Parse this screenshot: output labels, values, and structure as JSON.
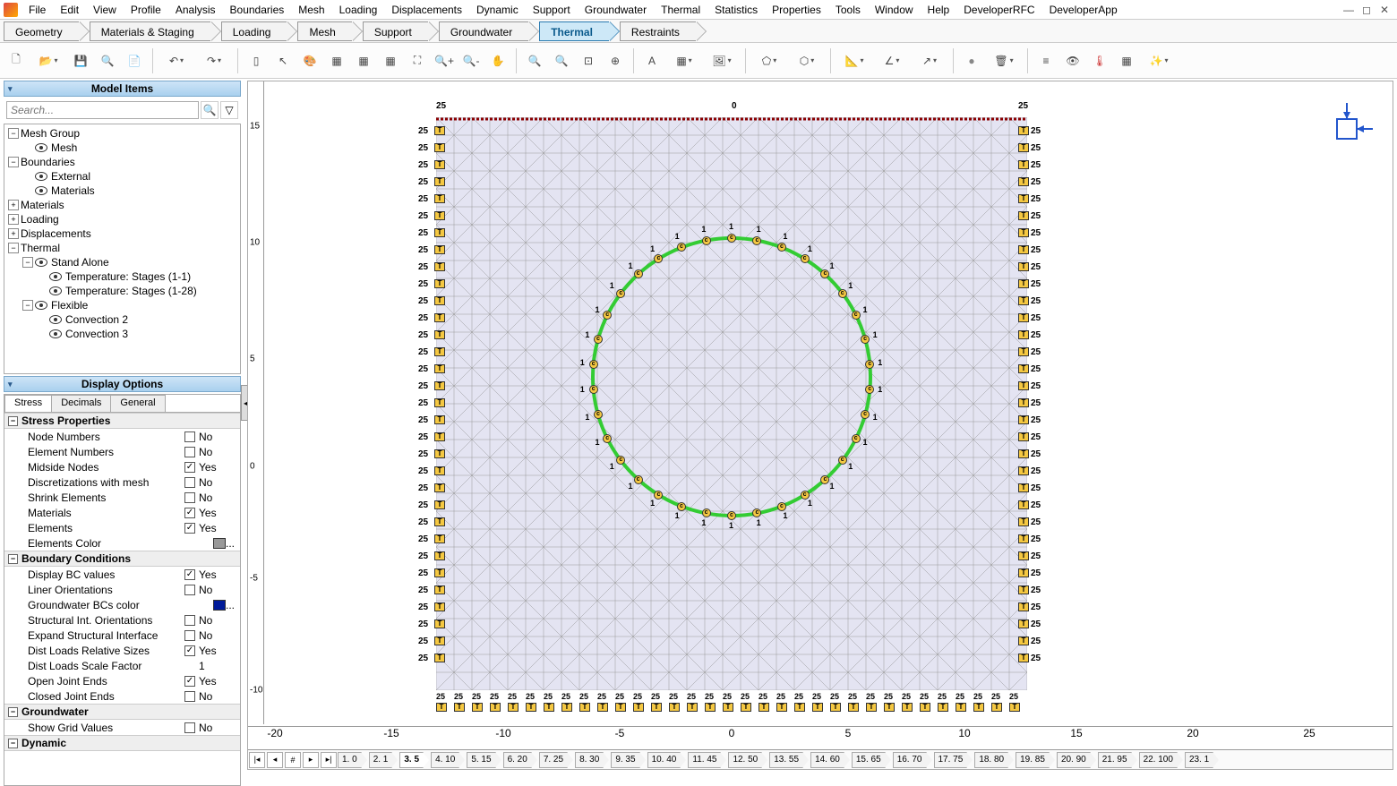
{
  "menu": [
    "File",
    "Edit",
    "View",
    "Profile",
    "Analysis",
    "Boundaries",
    "Mesh",
    "Loading",
    "Displacements",
    "Dynamic",
    "Support",
    "Groundwater",
    "Thermal",
    "Statistics",
    "Properties",
    "Tools",
    "Window",
    "Help",
    "DeveloperRFC",
    "DeveloperApp"
  ],
  "workflow": {
    "tabs": [
      "Geometry",
      "Materials & Staging",
      "Loading",
      "Mesh",
      "Support",
      "Groundwater",
      "Thermal",
      "Restraints"
    ],
    "active": "Thermal"
  },
  "model_items": {
    "title": "Model Items",
    "search_placeholder": "Search...",
    "tree": [
      {
        "label": "Mesh Group",
        "children": [
          {
            "label": "Mesh",
            "eye": true
          }
        ]
      },
      {
        "label": "Boundaries",
        "children": [
          {
            "label": "External",
            "eye": true
          },
          {
            "label": "Materials",
            "eye": true
          }
        ]
      },
      {
        "label": "Materials",
        "collapsed": true
      },
      {
        "label": "Loading",
        "collapsed": true
      },
      {
        "label": "Displacements",
        "collapsed": true
      },
      {
        "label": "Thermal",
        "children": [
          {
            "label": "Stand Alone",
            "eye": true,
            "children": [
              {
                "label": "Temperature: Stages (1-1)",
                "eye": true
              },
              {
                "label": "Temperature: Stages (1-28)",
                "eye": true
              }
            ]
          },
          {
            "label": "Flexible",
            "eye": true,
            "children": [
              {
                "label": "Convection 2",
                "eye": true
              },
              {
                "label": "Convection 3",
                "eye": true
              }
            ]
          }
        ]
      }
    ]
  },
  "display_options": {
    "title": "Display Options",
    "tabs": [
      "Stress",
      "Decimals",
      "General"
    ],
    "active_tab": "Stress",
    "sections": [
      {
        "name": "Stress Properties",
        "rows": [
          {
            "label": "Node Numbers",
            "checked": false,
            "val": "No"
          },
          {
            "label": "Element Numbers",
            "checked": false,
            "val": "No"
          },
          {
            "label": "Midside Nodes",
            "checked": true,
            "val": "Yes"
          },
          {
            "label": "Discretizations with mesh",
            "checked": false,
            "val": "No"
          },
          {
            "label": "Shrink Elements",
            "checked": false,
            "val": "No"
          },
          {
            "label": "Materials",
            "checked": true,
            "val": "Yes"
          },
          {
            "label": "Elements",
            "checked": true,
            "val": "Yes"
          },
          {
            "label": "Elements Color",
            "swatch": "#999",
            "ell": "..."
          }
        ]
      },
      {
        "name": "Boundary Conditions",
        "rows": [
          {
            "label": "Display BC values",
            "checked": true,
            "val": "Yes"
          },
          {
            "label": "Liner Orientations",
            "checked": false,
            "val": "No"
          },
          {
            "label": "Groundwater BCs color",
            "swatch": "#001a99",
            "ell": "..."
          },
          {
            "label": "Structural Int. Orientations",
            "checked": false,
            "val": "No"
          },
          {
            "label": "Expand Structural Interface",
            "checked": false,
            "val": "No"
          },
          {
            "label": "Dist Loads Relative Sizes",
            "checked": true,
            "val": "Yes"
          },
          {
            "label": "Dist Loads Scale Factor",
            "plain": "1"
          },
          {
            "label": "Open Joint Ends",
            "checked": true,
            "val": "Yes"
          },
          {
            "label": "Closed Joint Ends",
            "checked": false,
            "val": "No"
          }
        ]
      },
      {
        "name": "Groundwater",
        "rows": [
          {
            "label": "Show Grid Values",
            "checked": false,
            "val": "No"
          }
        ]
      },
      {
        "name": "Dynamic",
        "rows": []
      }
    ]
  },
  "canvas": {
    "top_labels": {
      "left": "25",
      "center": "0",
      "right": "25"
    },
    "boundary_temp": "25",
    "ruler_x": [
      {
        "pos": 30,
        "v": "-20"
      },
      {
        "pos": 160,
        "v": "-15"
      },
      {
        "pos": 285,
        "v": "-10"
      },
      {
        "pos": 415,
        "v": "-5"
      },
      {
        "pos": 540,
        "v": "0"
      },
      {
        "pos": 670,
        "v": "5"
      },
      {
        "pos": 800,
        "v": "10"
      },
      {
        "pos": 925,
        "v": "15"
      },
      {
        "pos": 1055,
        "v": "20"
      },
      {
        "pos": 1185,
        "v": "25"
      }
    ],
    "ruler_y": [
      {
        "pos": 50,
        "v": "15"
      },
      {
        "pos": 115,
        "v": ""
      },
      {
        "pos": 180,
        "v": "10"
      },
      {
        "pos": 245,
        "v": ""
      },
      {
        "pos": 310,
        "v": "5"
      },
      {
        "pos": 370,
        "v": ""
      },
      {
        "pos": 430,
        "v": "0"
      },
      {
        "pos": 495,
        "v": ""
      },
      {
        "pos": 555,
        "v": "-5"
      },
      {
        "pos": 620,
        "v": ""
      },
      {
        "pos": 680,
        "v": "-10"
      }
    ],
    "stages": [
      "1. 0",
      "2. 1",
      "3. 5",
      "4. 10",
      "5. 15",
      "6. 20",
      "7. 25",
      "8. 30",
      "9. 35",
      "10. 40",
      "11. 45",
      "12. 50",
      "13. 55",
      "14. 60",
      "15. 65",
      "16. 70",
      "17. 75",
      "18. 80",
      "19. 85",
      "20. 90",
      "21. 95",
      "22. 100",
      "23. 1"
    ],
    "active_stage": "3. 5"
  }
}
